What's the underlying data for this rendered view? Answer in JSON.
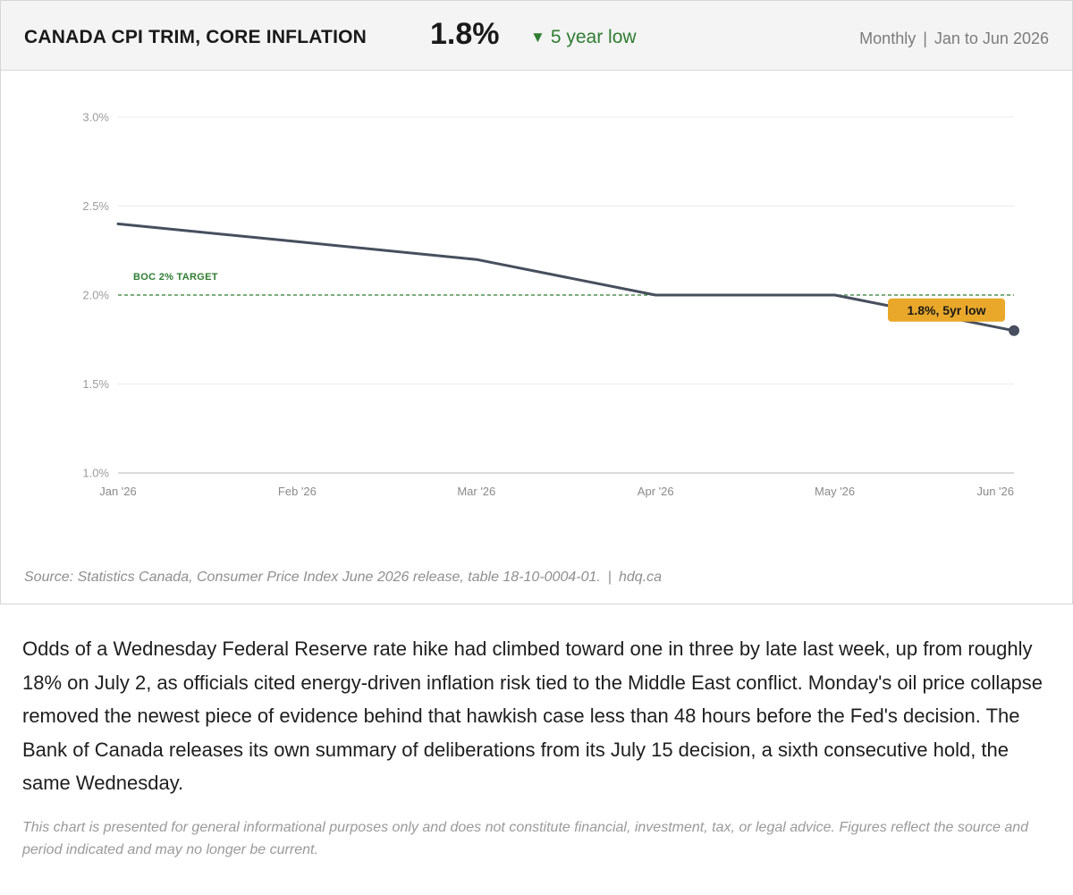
{
  "header": {
    "title": "CANADA CPI TRIM, CORE INFLATION",
    "value": "1.8%",
    "trend_icon": "triangle-down-icon",
    "trend_label": "5 year low",
    "frequency": "Monthly",
    "separator": "|",
    "range": "Jan to Jun 2026"
  },
  "colors": {
    "line": "#474f5e",
    "target": "#2f7d32",
    "callout": "#e9a82a",
    "grid": "#ebebeb",
    "header_bg": "#f4f4f4"
  },
  "chart_data": {
    "type": "line",
    "title": "CANADA CPI TRIM, CORE INFLATION",
    "xlabel": "",
    "ylabel": "",
    "categories": [
      "Jan '26",
      "Feb '26",
      "Mar '26",
      "Apr '26",
      "May '26",
      "Jun '26"
    ],
    "values": [
      2.4,
      2.3,
      2.2,
      2.0,
      2.0,
      1.8
    ],
    "ylim": [
      1.0,
      3.0
    ],
    "y_ticks": [
      1.0,
      1.5,
      2.0,
      2.5,
      3.0
    ],
    "y_tick_labels": [
      "1.0%",
      "1.5%",
      "2.0%",
      "2.5%",
      "3.0%"
    ],
    "grid": true,
    "legend": "none",
    "reference_line": {
      "value": 2.0,
      "label": "BOC 2% TARGET"
    },
    "annotation": {
      "index": 5,
      "text": "1.8%, 5yr low"
    }
  },
  "source": {
    "text": "Source: Statistics Canada, Consumer Price Index June 2026 release, table 18-10-0004-01.",
    "separator": "|",
    "site": "hdq.ca"
  },
  "body_text": "Odds of a Wednesday Federal Reserve rate hike had climbed toward one in three by late last week, up from roughly 18% on July 2, as officials cited energy-driven inflation risk tied to the Middle East conflict. Monday's oil price collapse removed the newest piece of evidence behind that hawkish case less than 48 hours before the Fed's decision. The Bank of Canada releases its own summary of deliberations from its July 15 decision, a sixth consecutive hold, the same Wednesday.",
  "disclaimer": "This chart is presented for general informational purposes only and does not constitute financial, investment, tax, or legal advice. Figures reflect the source and period indicated and may no longer be current."
}
